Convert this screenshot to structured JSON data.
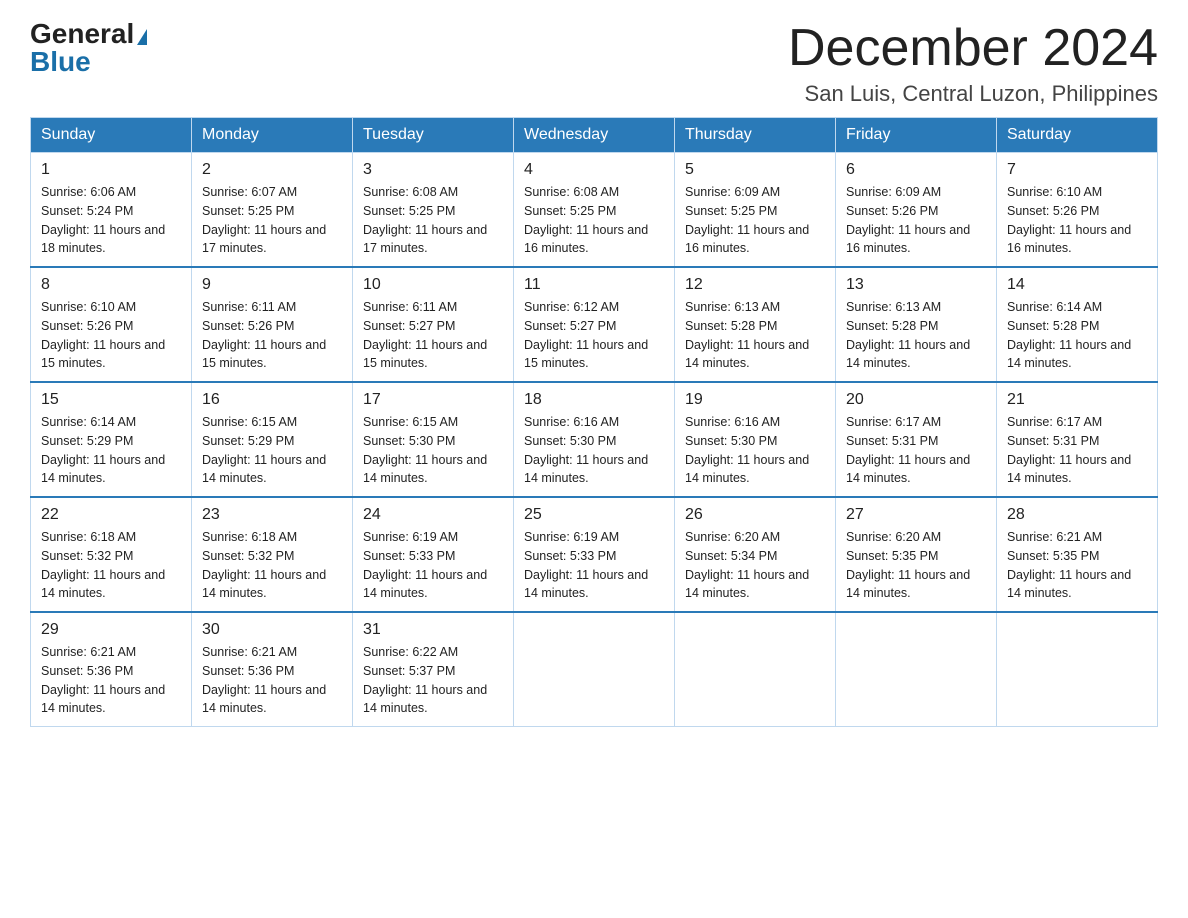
{
  "header": {
    "logo_general": "General",
    "logo_blue": "Blue",
    "month_title": "December 2024",
    "location": "San Luis, Central Luzon, Philippines"
  },
  "weekdays": [
    "Sunday",
    "Monday",
    "Tuesday",
    "Wednesday",
    "Thursday",
    "Friday",
    "Saturday"
  ],
  "weeks": [
    [
      {
        "day": "1",
        "sunrise": "6:06 AM",
        "sunset": "5:24 PM",
        "daylight": "11 hours and 18 minutes."
      },
      {
        "day": "2",
        "sunrise": "6:07 AM",
        "sunset": "5:25 PM",
        "daylight": "11 hours and 17 minutes."
      },
      {
        "day": "3",
        "sunrise": "6:08 AM",
        "sunset": "5:25 PM",
        "daylight": "11 hours and 17 minutes."
      },
      {
        "day": "4",
        "sunrise": "6:08 AM",
        "sunset": "5:25 PM",
        "daylight": "11 hours and 16 minutes."
      },
      {
        "day": "5",
        "sunrise": "6:09 AM",
        "sunset": "5:25 PM",
        "daylight": "11 hours and 16 minutes."
      },
      {
        "day": "6",
        "sunrise": "6:09 AM",
        "sunset": "5:26 PM",
        "daylight": "11 hours and 16 minutes."
      },
      {
        "day": "7",
        "sunrise": "6:10 AM",
        "sunset": "5:26 PM",
        "daylight": "11 hours and 16 minutes."
      }
    ],
    [
      {
        "day": "8",
        "sunrise": "6:10 AM",
        "sunset": "5:26 PM",
        "daylight": "11 hours and 15 minutes."
      },
      {
        "day": "9",
        "sunrise": "6:11 AM",
        "sunset": "5:26 PM",
        "daylight": "11 hours and 15 minutes."
      },
      {
        "day": "10",
        "sunrise": "6:11 AM",
        "sunset": "5:27 PM",
        "daylight": "11 hours and 15 minutes."
      },
      {
        "day": "11",
        "sunrise": "6:12 AM",
        "sunset": "5:27 PM",
        "daylight": "11 hours and 15 minutes."
      },
      {
        "day": "12",
        "sunrise": "6:13 AM",
        "sunset": "5:28 PM",
        "daylight": "11 hours and 14 minutes."
      },
      {
        "day": "13",
        "sunrise": "6:13 AM",
        "sunset": "5:28 PM",
        "daylight": "11 hours and 14 minutes."
      },
      {
        "day": "14",
        "sunrise": "6:14 AM",
        "sunset": "5:28 PM",
        "daylight": "11 hours and 14 minutes."
      }
    ],
    [
      {
        "day": "15",
        "sunrise": "6:14 AM",
        "sunset": "5:29 PM",
        "daylight": "11 hours and 14 minutes."
      },
      {
        "day": "16",
        "sunrise": "6:15 AM",
        "sunset": "5:29 PM",
        "daylight": "11 hours and 14 minutes."
      },
      {
        "day": "17",
        "sunrise": "6:15 AM",
        "sunset": "5:30 PM",
        "daylight": "11 hours and 14 minutes."
      },
      {
        "day": "18",
        "sunrise": "6:16 AM",
        "sunset": "5:30 PM",
        "daylight": "11 hours and 14 minutes."
      },
      {
        "day": "19",
        "sunrise": "6:16 AM",
        "sunset": "5:30 PM",
        "daylight": "11 hours and 14 minutes."
      },
      {
        "day": "20",
        "sunrise": "6:17 AM",
        "sunset": "5:31 PM",
        "daylight": "11 hours and 14 minutes."
      },
      {
        "day": "21",
        "sunrise": "6:17 AM",
        "sunset": "5:31 PM",
        "daylight": "11 hours and 14 minutes."
      }
    ],
    [
      {
        "day": "22",
        "sunrise": "6:18 AM",
        "sunset": "5:32 PM",
        "daylight": "11 hours and 14 minutes."
      },
      {
        "day": "23",
        "sunrise": "6:18 AM",
        "sunset": "5:32 PM",
        "daylight": "11 hours and 14 minutes."
      },
      {
        "day": "24",
        "sunrise": "6:19 AM",
        "sunset": "5:33 PM",
        "daylight": "11 hours and 14 minutes."
      },
      {
        "day": "25",
        "sunrise": "6:19 AM",
        "sunset": "5:33 PM",
        "daylight": "11 hours and 14 minutes."
      },
      {
        "day": "26",
        "sunrise": "6:20 AM",
        "sunset": "5:34 PM",
        "daylight": "11 hours and 14 minutes."
      },
      {
        "day": "27",
        "sunrise": "6:20 AM",
        "sunset": "5:35 PM",
        "daylight": "11 hours and 14 minutes."
      },
      {
        "day": "28",
        "sunrise": "6:21 AM",
        "sunset": "5:35 PM",
        "daylight": "11 hours and 14 minutes."
      }
    ],
    [
      {
        "day": "29",
        "sunrise": "6:21 AM",
        "sunset": "5:36 PM",
        "daylight": "11 hours and 14 minutes."
      },
      {
        "day": "30",
        "sunrise": "6:21 AM",
        "sunset": "5:36 PM",
        "daylight": "11 hours and 14 minutes."
      },
      {
        "day": "31",
        "sunrise": "6:22 AM",
        "sunset": "5:37 PM",
        "daylight": "11 hours and 14 minutes."
      },
      null,
      null,
      null,
      null
    ]
  ]
}
